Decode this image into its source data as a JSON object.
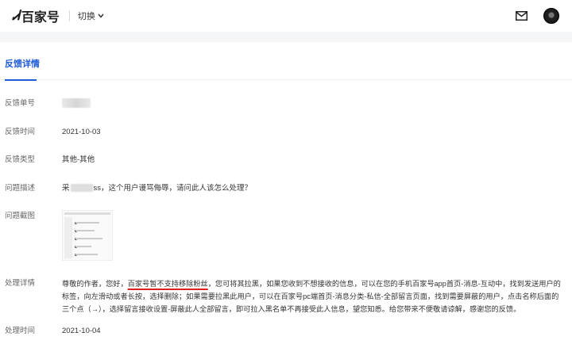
{
  "header": {
    "logo_mark": "Ꮧ",
    "logo_text": "百家号",
    "switch_label": "切换",
    "mail_icon": "mail-icon",
    "avatar_icon": "avatar"
  },
  "tab": {
    "label": "反馈详情"
  },
  "rows": {
    "id": {
      "label": "反馈单号",
      "value": ""
    },
    "time": {
      "label": "反馈时间",
      "value": "2021-10-03"
    },
    "type": {
      "label": "反馈类型",
      "value": "其他-其他"
    },
    "desc": {
      "label": "问题描述",
      "prefix": "采",
      "suffix": "ss，这个用户谩骂侮辱，请问此人该怎么处理？"
    },
    "screenshot": {
      "label": "问题截图"
    },
    "reply": {
      "label": "处理详情",
      "part1": "尊敬的作者，您好，",
      "highlight": "百家号暂不支持移除粉丝",
      "part2": "，您可将其拉黑，如果您收到不想接收的信息，可以在您的手机百家号app首页-消息-互动中，找到发送用户的标签，向左滑动或者长按，选择删除；如果需要拉黑此用户，可以在百家号pc端首页-消息分类-私信-全部留言页面，找到需要屏蔽的用户，点击名称后面的三个点（→），选择留言接收设置-屏蔽此人全部留言，即可拉入黑名单不再接受此人信息，望您知悉。给您带来不便敬请谅解，感谢您的反馈。"
    },
    "handle_time": {
      "label": "处理时间",
      "value": "2021-10-04"
    }
  },
  "colors": {
    "accent": "#1e5bd8",
    "highlight_underline": "#e02020"
  }
}
